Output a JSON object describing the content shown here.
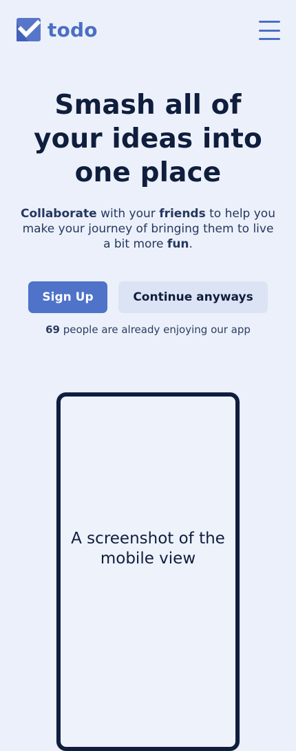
{
  "app": {
    "logo_text": "todo"
  },
  "navbar": {
    "menu_icon": "hamburger-menu-icon"
  },
  "hero": {
    "title": "Smash all of your ideas into one place",
    "subtitle": {
      "part1": "Collaborate",
      "part2": " with your ",
      "part3": "friends",
      "part4": " to help you make your journey of bringing them to live a bit more ",
      "part5": "fun",
      "part6": "."
    }
  },
  "actions": {
    "signup_label": "Sign Up",
    "continue_label": "Continue anyways"
  },
  "social_proof": {
    "count": "69",
    "text": " people are already enjoying our app"
  },
  "preview": {
    "caption": "A screenshot of the mobile view"
  },
  "colors": {
    "background": "#ecf0fa",
    "brand": "#4a6fc3",
    "primary_button": "#4e73c9",
    "secondary_button": "#dce3f4",
    "text_dark": "#0f1e3d"
  },
  "icons": {
    "logo": "checkmark-box-icon",
    "menu": "hamburger-menu-icon"
  }
}
